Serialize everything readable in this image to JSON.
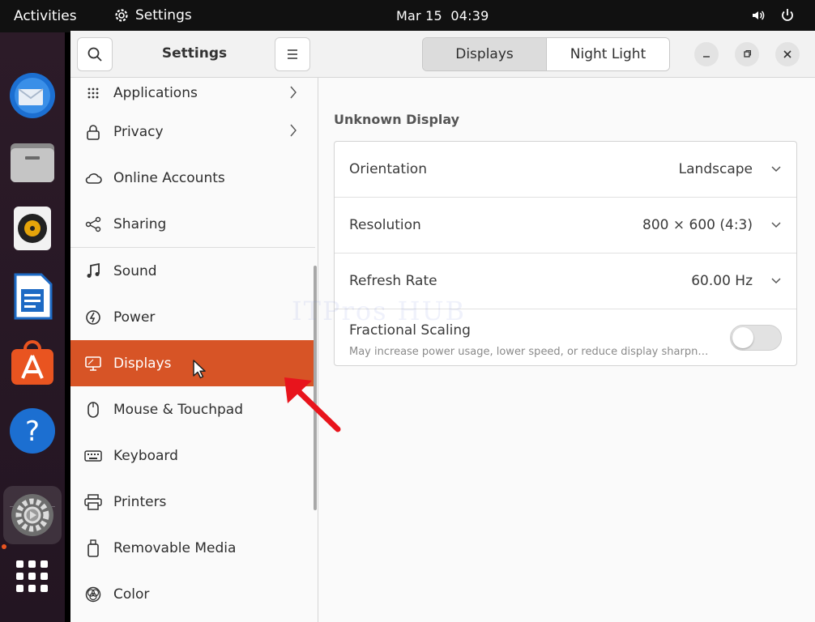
{
  "topbar": {
    "activities": "Activities",
    "app_name": "Settings",
    "date": "Mar 15",
    "time": "04:39"
  },
  "dock": {
    "items": [
      "thunderbird-icon",
      "files-icon",
      "rhythmbox-icon",
      "writer-icon",
      "app-center-icon",
      "help-icon",
      "settings-icon",
      "app-grid-icon"
    ]
  },
  "sidebar": {
    "title": "Settings",
    "items": [
      {
        "label": "Applications",
        "icon": "grid-icon",
        "chevron": true
      },
      {
        "label": "Privacy",
        "icon": "lock-icon",
        "chevron": true
      },
      {
        "label": "Online Accounts",
        "icon": "cloud-icon"
      },
      {
        "label": "Sharing",
        "icon": "share-icon"
      },
      {
        "label": "Sound",
        "icon": "music-note-icon"
      },
      {
        "label": "Power",
        "icon": "power-icon"
      },
      {
        "label": "Displays",
        "icon": "display-icon",
        "active": true
      },
      {
        "label": "Mouse & Touchpad",
        "icon": "mouse-icon"
      },
      {
        "label": "Keyboard",
        "icon": "keyboard-icon"
      },
      {
        "label": "Printers",
        "icon": "printer-icon"
      },
      {
        "label": "Removable Media",
        "icon": "usb-icon"
      },
      {
        "label": "Color",
        "icon": "color-icon"
      }
    ]
  },
  "main": {
    "tabs": [
      {
        "label": "Displays",
        "selected": true
      },
      {
        "label": "Night Light",
        "selected": false
      }
    ],
    "section_title": "Unknown Display",
    "rows": {
      "orientation": {
        "label": "Orientation",
        "value": "Landscape"
      },
      "resolution": {
        "label": "Resolution",
        "value": "800 × 600 (4:3)"
      },
      "refresh_rate": {
        "label": "Refresh Rate",
        "value": "60.00 Hz"
      },
      "fractional_scaling": {
        "label": "Fractional Scaling",
        "description": "May increase power usage, lower speed, or reduce display sharpness.",
        "enabled": false
      }
    }
  },
  "watermark": "ITPros HUB",
  "colors": {
    "accent": "#d75426",
    "annotation_arrow": "#e8141c"
  }
}
